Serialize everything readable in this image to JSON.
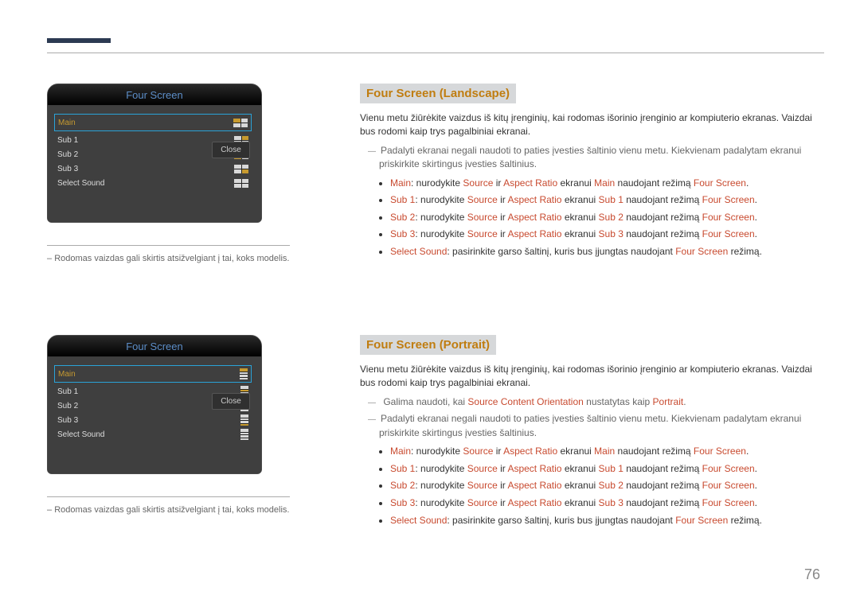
{
  "page_number": "76",
  "osd": {
    "title": "Four Screen",
    "items": [
      "Main",
      "Sub 1",
      "Sub 2",
      "Sub 3",
      "Select Sound"
    ],
    "close": "Close"
  },
  "img_note": "Rodomas vaizdas gali skirtis atsižvelgiant į tai, koks modelis.",
  "landscape": {
    "heading": "Four Screen (Landscape)",
    "para": "Vienu metu žiūrėkite vaizdus iš kitų įrenginių, kai rodomas išorinio įrenginio ar kompiuterio ekranas. Vaizdai bus rodomi kaip trys pagalbiniai ekranai.",
    "note1": "Padalyti ekranai negali naudoti to paties įvesties šaltinio vienu metu. Kiekvienam padalytam ekranui priskirkite skirtingus įvesties šaltinius.",
    "bullets": [
      {
        "k": "Main",
        "t1": ": nurodykite ",
        "s": "Source",
        "t2": " ir ",
        "a": "Aspect Ratio",
        "t3": " ekranui ",
        "e": "Main",
        "t4": " naudojant režimą ",
        "f": "Four Screen",
        "t5": "."
      },
      {
        "k": "Sub 1",
        "t1": ": nurodykite ",
        "s": "Source",
        "t2": " ir ",
        "a": "Aspect Ratio",
        "t3": " ekranui ",
        "e": "Sub 1",
        "t4": " naudojant režimą ",
        "f": "Four Screen",
        "t5": "."
      },
      {
        "k": "Sub 2",
        "t1": ": nurodykite ",
        "s": "Source",
        "t2": " ir ",
        "a": "Aspect Ratio",
        "t3": " ekranui ",
        "e": "Sub 2",
        "t4": " naudojant režimą ",
        "f": "Four Screen",
        "t5": "."
      },
      {
        "k": "Sub 3",
        "t1": ": nurodykite ",
        "s": "Source",
        "t2": " ir ",
        "a": "Aspect Ratio",
        "t3": " ekranui ",
        "e": "Sub 3",
        "t4": " naudojant režimą ",
        "f": "Four Screen",
        "t5": "."
      },
      {
        "k": "Select Sound",
        "t1": ": pasirinkite garso šaltinį, kuris bus įjungtas naudojant ",
        "f": "Four Screen",
        "t5": " režimą."
      }
    ]
  },
  "portrait": {
    "heading": "Four Screen (Portrait)",
    "para": "Vienu metu žiūrėkite vaizdus iš kitų įrenginių, kai rodomas išorinio įrenginio ar kompiuterio ekranas. Vaizdai bus rodomi kaip trys pagalbiniai ekranai.",
    "note0a": "Galima naudoti, kai ",
    "note0b": "Source Content Orientation",
    "note0c": " nustatytas kaip ",
    "note0d": "Portrait",
    "note0e": ".",
    "note1": "Padalyti ekranai negali naudoti to paties įvesties šaltinio vienu metu. Kiekvienam padalytam ekranui priskirkite skirtingus įvesties šaltinius.",
    "bullets": [
      {
        "k": "Main",
        "t1": ": nurodykite ",
        "s": "Source",
        "t2": " ir ",
        "a": "Aspect Ratio",
        "t3": " ekranui ",
        "e": "Main",
        "t4": " naudojant režimą ",
        "f": "Four Screen",
        "t5": "."
      },
      {
        "k": "Sub 1",
        "t1": ": nurodykite ",
        "s": "Source",
        "t2": " ir ",
        "a": "Aspect Ratio",
        "t3": " ekranui ",
        "e": "Sub 1",
        "t4": " naudojant režimą ",
        "f": "Four Screen",
        "t5": "."
      },
      {
        "k": "Sub 2",
        "t1": ": nurodykite ",
        "s": "Source",
        "t2": " ir ",
        "a": "Aspect Ratio",
        "t3": " ekranui ",
        "e": "Sub 2",
        "t4": " naudojant režimą ",
        "f": "Four Screen",
        "t5": "."
      },
      {
        "k": "Sub 3",
        "t1": ": nurodykite ",
        "s": "Source",
        "t2": " ir ",
        "a": "Aspect Ratio",
        "t3": " ekranui ",
        "e": "Sub 3",
        "t4": " naudojant režimą ",
        "f": "Four Screen",
        "t5": "."
      },
      {
        "k": "Select Sound",
        "t1": ": pasirinkite garso šaltinį, kuris bus įjungtas naudojant ",
        "f": "Four Screen",
        "t5": " režimą."
      }
    ]
  }
}
